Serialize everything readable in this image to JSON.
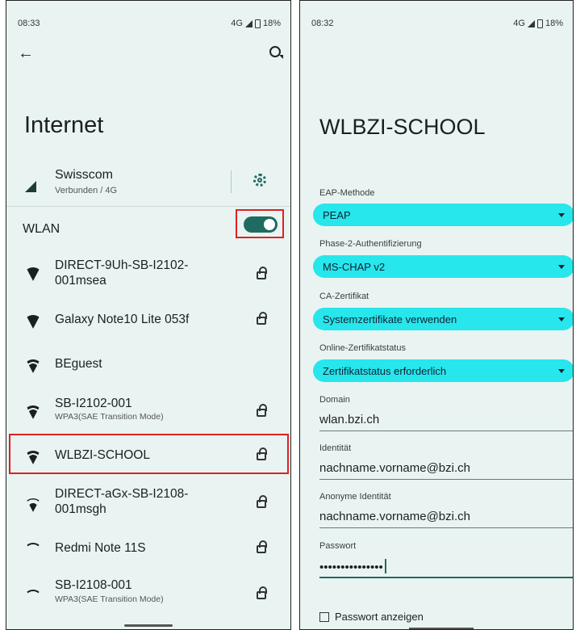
{
  "left_screen": {
    "status": {
      "time": "08:33",
      "network": "4G",
      "battery": "18%"
    },
    "title": "Internet",
    "carrier": {
      "name": "Swisscom",
      "status": "Verbunden / 4G"
    },
    "wlan_label": "WLAN",
    "wlan_enabled": true,
    "networks": [
      {
        "name": "DIRECT-9Uh-SB-I2102-001msea",
        "sub": "",
        "locked": true,
        "signal": "full"
      },
      {
        "name": "Galaxy Note10 Lite 053f",
        "sub": "",
        "locked": true,
        "signal": "full"
      },
      {
        "name": "BEguest",
        "sub": "",
        "locked": false,
        "signal": "strong"
      },
      {
        "name": "SB-I2102-001",
        "sub": "WPA3(SAE Transition Mode)",
        "locked": true,
        "signal": "strong"
      },
      {
        "name": "WLBZI-SCHOOL",
        "sub": "",
        "locked": true,
        "signal": "strong"
      },
      {
        "name": "DIRECT-aGx-SB-I2108-001msgh",
        "sub": "",
        "locked": true,
        "signal": "mid"
      },
      {
        "name": "Redmi Note 11S",
        "sub": "",
        "locked": true,
        "signal": "low"
      },
      {
        "name": "SB-I2108-001",
        "sub": "WPA3(SAE Transition Mode)",
        "locked": true,
        "signal": "low"
      }
    ]
  },
  "right_screen": {
    "status": {
      "time": "08:32",
      "network": "4G",
      "battery": "18%"
    },
    "title": "WLBZI-SCHOOL",
    "eap_label": "EAP-Methode",
    "eap_value": "PEAP",
    "phase2_label": "Phase-2-Authentifizierung",
    "phase2_value": "MS-CHAP v2",
    "ca_label": "CA-Zertifikat",
    "ca_value": "Systemzertifikate verwenden",
    "ocsp_label": "Online-Zertifikatstatus",
    "ocsp_value": "Zertifikatstatus erforderlich",
    "domain_label": "Domain",
    "domain_value": "wlan.bzi.ch",
    "identity_label": "Identität",
    "identity_value": "nachname.vorname@bzi.ch",
    "anon_label": "Anonyme Identität",
    "anon_value": "nachname.vorname@bzi.ch",
    "password_label": "Passwort",
    "password_value": "•••••••••••••••",
    "show_password_label": "Passwort anzeigen"
  },
  "colors": {
    "accent": "#1f6b61",
    "dropdown": "#27e6ec",
    "highlight": "#e02020",
    "background": "#e9f4f2"
  }
}
